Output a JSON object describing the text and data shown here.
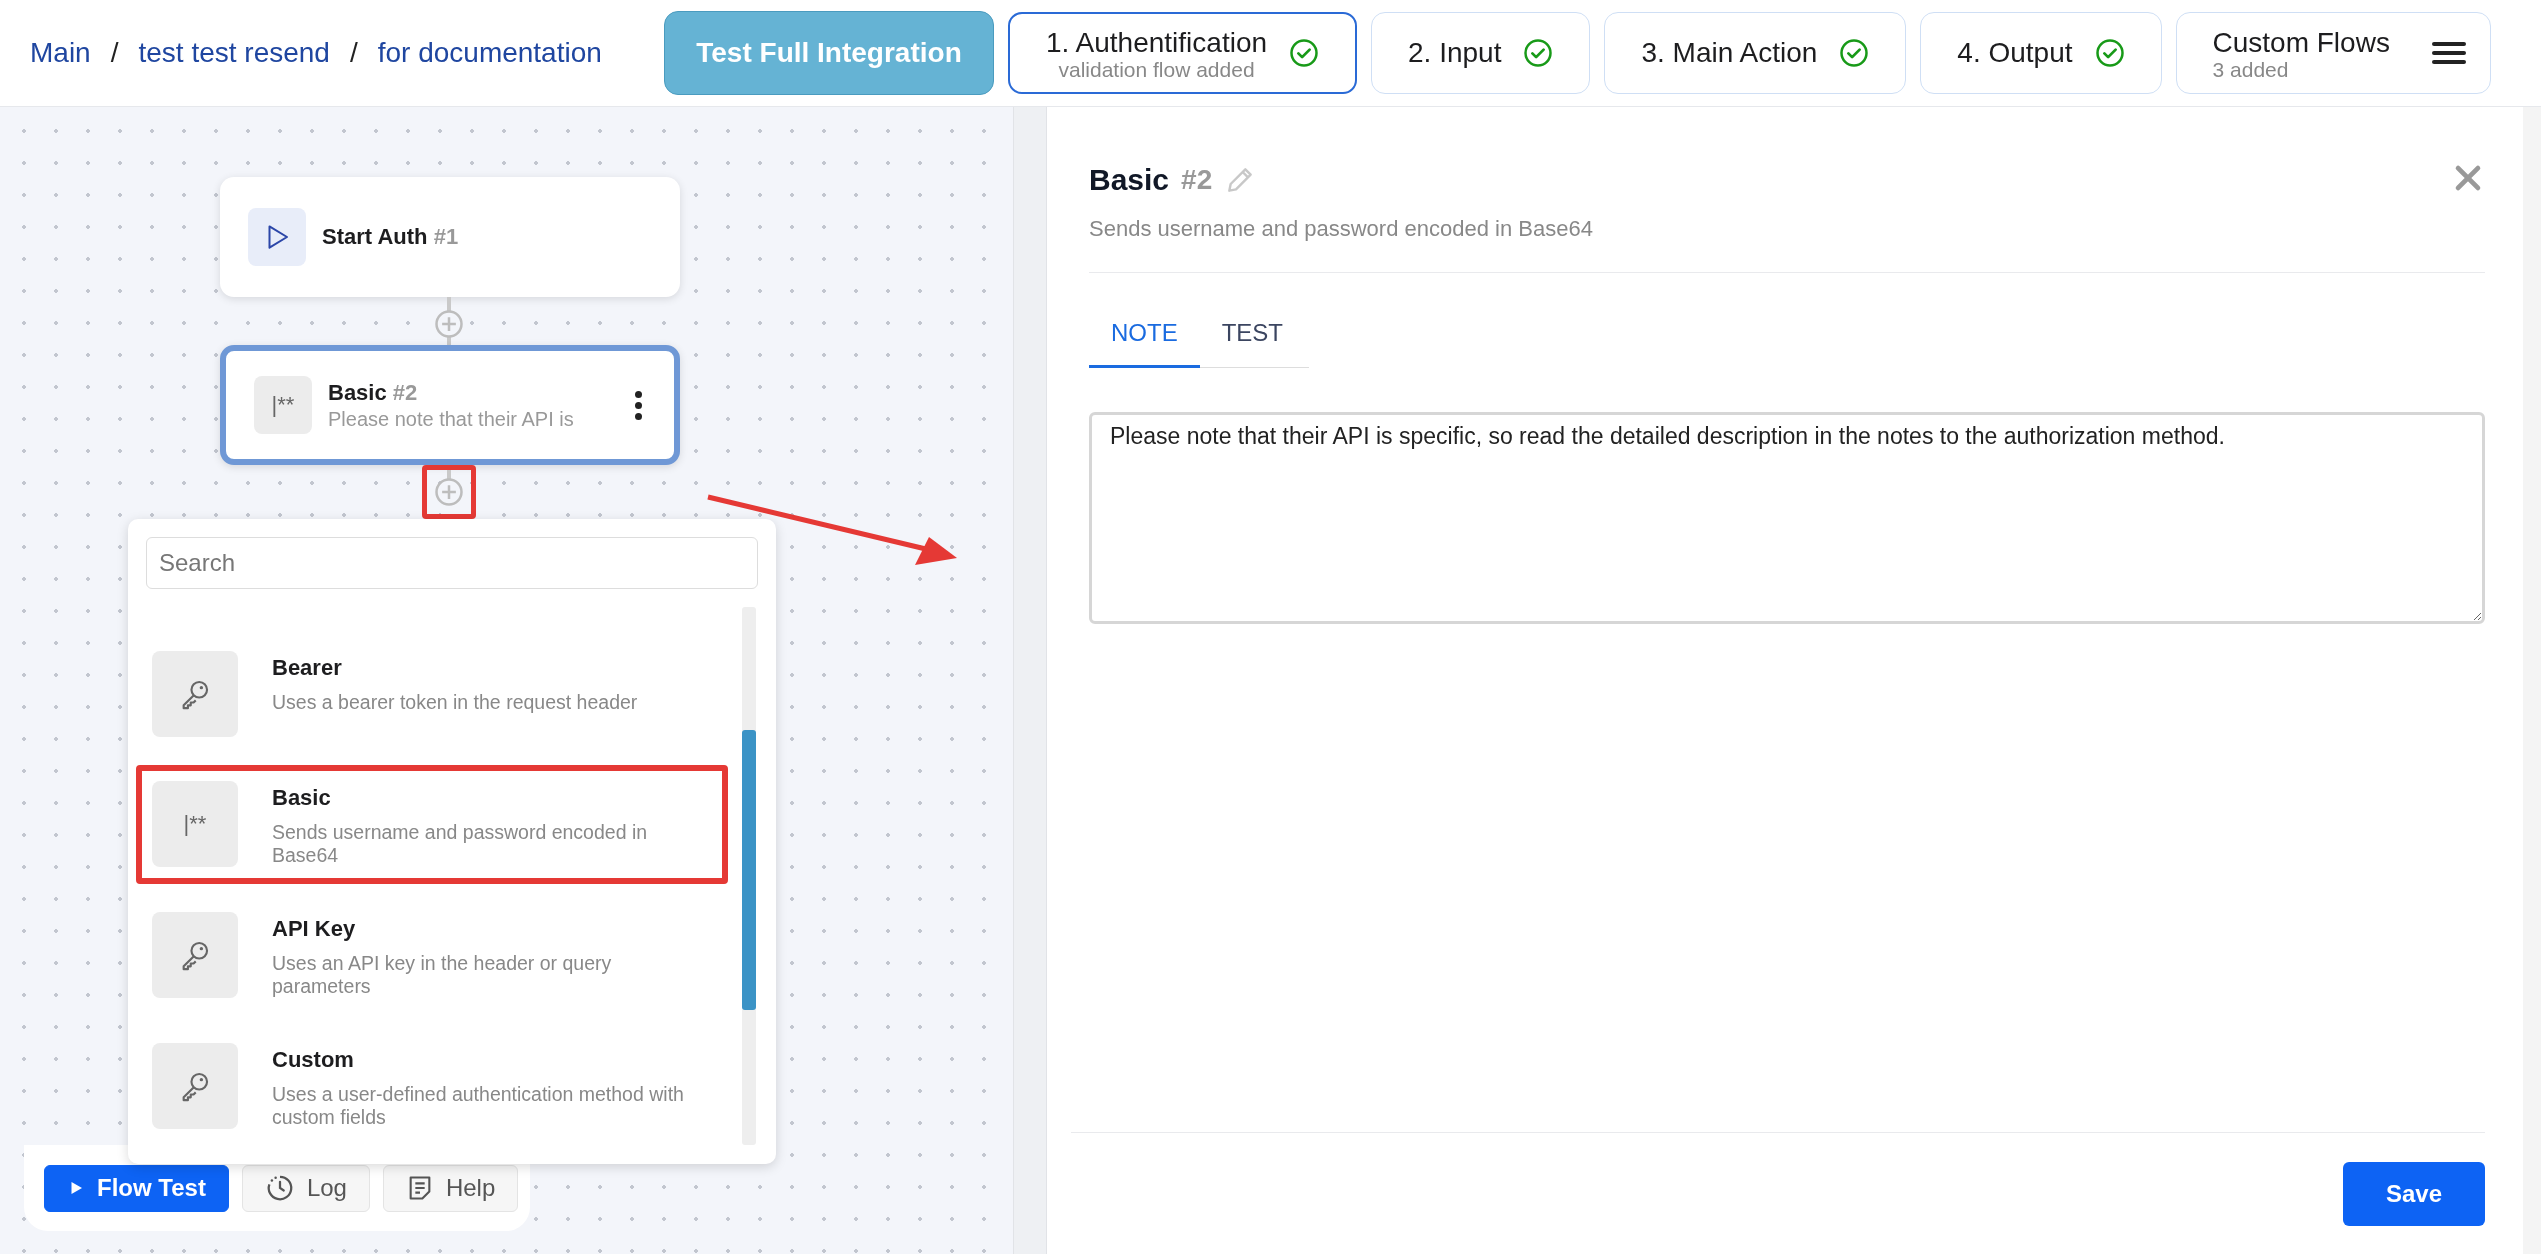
{
  "breadcrumb": [
    {
      "label": "Main",
      "separator": "/"
    },
    {
      "label": "test test resend",
      "separator": "/"
    },
    {
      "label": "for documentation"
    }
  ],
  "test_button": "Test Full Integration",
  "steps": [
    {
      "label": "1. Authentification",
      "subtitle": "validation flow added",
      "done": true,
      "selected": true
    },
    {
      "label": "2. Input",
      "done": true,
      "selected": false
    },
    {
      "label": "3. Main Action",
      "done": true,
      "selected": false
    },
    {
      "label": "4. Output",
      "done": true,
      "selected": false
    }
  ],
  "custom_flows": {
    "label": "Custom Flows",
    "subtitle": "3 added"
  },
  "nodes": [
    {
      "kind": "start",
      "title": "Start Auth",
      "number": "#1",
      "selected": false,
      "add_highlighted": false
    },
    {
      "kind": "mask",
      "icon_text": "|**",
      "title": "Basic",
      "number": "#2",
      "description": "Please note that their API is",
      "selected": true,
      "add_highlighted": true
    }
  ],
  "picker": {
    "placeholder": "Search",
    "items": [
      {
        "kind": "key",
        "title": "Bearer",
        "description": "Uses a bearer token in the request header",
        "highlighted": false
      },
      {
        "kind": "mask",
        "icon_text": "|**",
        "title": "Basic",
        "description": "Sends username and password encoded in Base64",
        "highlighted": true
      },
      {
        "kind": "key",
        "title": "API Key",
        "description": "Uses an API key in the header or query parameters",
        "highlighted": false
      },
      {
        "kind": "key",
        "title": "Custom",
        "description": "Uses a user-defined authentication method with custom fields",
        "highlighted": false
      }
    ]
  },
  "toolbar": [
    {
      "kind": "play",
      "label": "Flow Test",
      "primary": true
    },
    {
      "kind": "clock",
      "label": "Log",
      "primary": false
    },
    {
      "kind": "note",
      "label": "Help",
      "primary": false
    }
  ],
  "panel": {
    "title": "Basic",
    "number": "#2",
    "description": "Sends username and password encoded in Base64",
    "tabs": [
      {
        "label": "NOTE",
        "selected": true
      },
      {
        "label": "TEST",
        "selected": false
      }
    ],
    "note": "Please note that their API is specific, so read the detailed description in the notes to the authorization method.",
    "save": "Save"
  }
}
